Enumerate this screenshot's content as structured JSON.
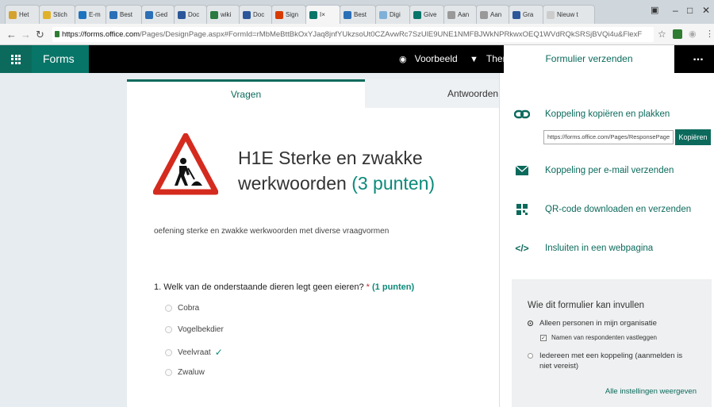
{
  "browser": {
    "tabs": [
      {
        "label": "Het",
        "color": "#d4a32f"
      },
      {
        "label": "Stich",
        "color": "#e0b22a"
      },
      {
        "label": "E-m",
        "color": "#1e73be"
      },
      {
        "label": "Best",
        "color": "#2b6fb6"
      },
      {
        "label": "Ged",
        "color": "#2b6fb6"
      },
      {
        "label": "Doc",
        "color": "#2b579a"
      },
      {
        "label": "wiki",
        "color": "#2b7a3f"
      },
      {
        "label": "Doc",
        "color": "#2b579a"
      },
      {
        "label": "Sign",
        "color": "#d83b01"
      },
      {
        "label": "I",
        "color": "#077568"
      },
      {
        "label": "Best",
        "color": "#2b6fb6"
      },
      {
        "label": "Digi",
        "color": "#7fb0d8"
      },
      {
        "label": "Give",
        "color": "#077568"
      },
      {
        "label": "Aan",
        "color": "#999999"
      },
      {
        "label": "Aan",
        "color": "#999999"
      },
      {
        "label": "Gra",
        "color": "#2b579a"
      },
      {
        "label": "Nieuw t",
        "color": "#cccccc"
      }
    ],
    "url_host": "https://forms.office.com",
    "url_path": "/Pages/DesignPage.aspx#FormId=rMbMeBttBkOxYJaq8jnfYUkzsoUt0CZAvwRc7SzUlE9UNE1NMFBJWkNPRkwxOEQ1WVdRQkSRSjBVQi4u&FlexF"
  },
  "appbar": {
    "brand": "Forms",
    "preview_label": "Voorbeeld",
    "theme_label": "Thema",
    "send_label": "Formulier verzenden",
    "more_label": "..."
  },
  "form": {
    "tab_questions": "Vragen",
    "tab_answers": "Antwoorden",
    "title_line1": "H1E Sterke en zwakke",
    "title_line2": "werkwoorden",
    "title_points": "(3 punten)",
    "description": "oefening sterke en zwakke werkwoorden met diverse vraagvormen",
    "question_text": "1. Welk van de onderstaande dieren legt geen eieren?",
    "question_required": "*",
    "question_points": "(1 punten)",
    "options": [
      "Cobra",
      "Vogelbekdier",
      "Veelvraat",
      "Zwaluw"
    ],
    "correct_option": "Veelvraat"
  },
  "send_panel": {
    "copy_link_label": "Koppeling kopiëren en plakken",
    "link_value": "https://forms.office.com/Pages/ResponsePage",
    "copy_button": "Kopiëren",
    "email_label": "Koppeling per e-mail verzenden",
    "qr_label": "QR-code downloaden en verzenden",
    "embed_label": "Insluiten in een webpagina",
    "embed_icon_text": "</>",
    "permissions_title": "Wie dit formulier kan invullen",
    "option_org": "Alleen personen in mijn organisatie",
    "option_org_sub": "Namen van respondenten vastleggen",
    "option_anyone_line1": "Iedereen met een koppeling (aanmelden is",
    "option_anyone_line2": "niet vereist)",
    "all_settings": "Alle instellingen weergeven"
  },
  "colors": {
    "accent": "#0b6a5c",
    "points": "#0b8a7a",
    "required": "#c62828"
  }
}
